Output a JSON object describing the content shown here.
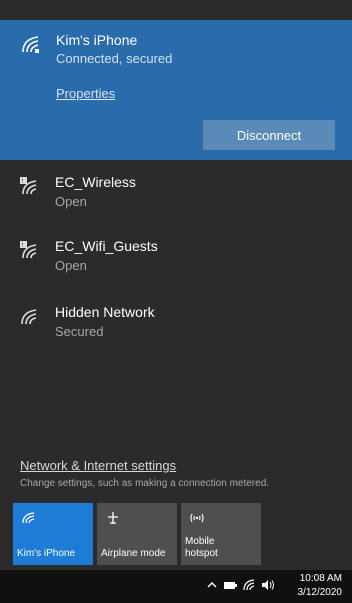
{
  "connected_network": {
    "name": "Kim's iPhone",
    "status": "Connected, secured",
    "properties_label": "Properties",
    "disconnect_label": "Disconnect"
  },
  "networks": [
    {
      "name": "EC_Wireless",
      "status": "Open",
      "icon": "wifi-open-icon"
    },
    {
      "name": "EC_Wifi_Guests",
      "status": "Open",
      "icon": "wifi-open-icon"
    },
    {
      "name": "Hidden Network",
      "status": "Secured",
      "icon": "wifi-icon"
    }
  ],
  "settings": {
    "link_label": "Network & Internet settings",
    "description": "Change settings, such as making a connection metered."
  },
  "quick_actions": [
    {
      "label": "Kim's iPhone",
      "icon": "wifi-icon",
      "active": true
    },
    {
      "label": "Airplane mode",
      "icon": "airplane-icon",
      "active": false
    },
    {
      "label": "Mobile hotspot",
      "icon": "hotspot-icon",
      "active": false
    }
  ],
  "taskbar": {
    "time": "10:08 AM",
    "date": "3/12/2020"
  },
  "colors": {
    "accent": "#2a6cab",
    "tile_active": "#1e7bd6",
    "background": "#2b2b2b"
  }
}
